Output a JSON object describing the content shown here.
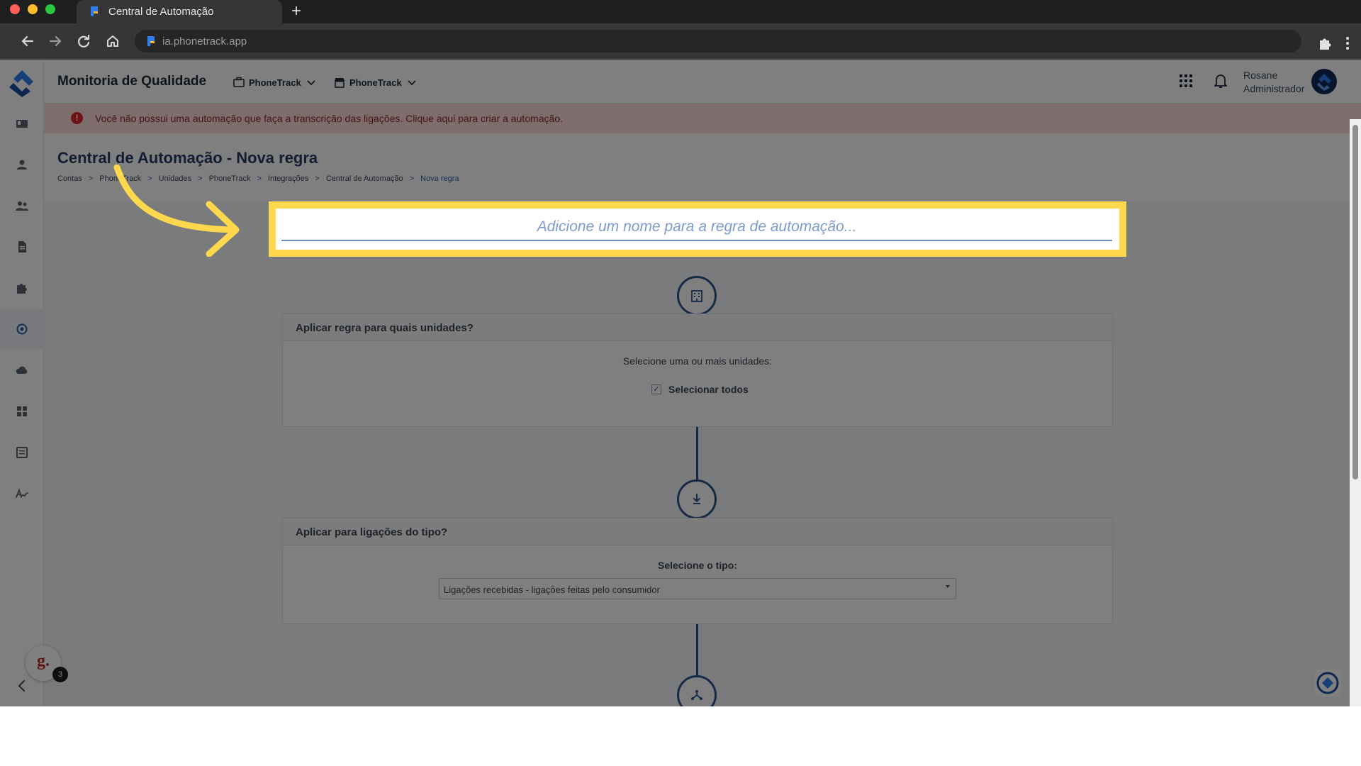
{
  "browser": {
    "tab_title": "Central de Automação",
    "url": "ia.phonetrack.app",
    "new_tab_symbol": "+"
  },
  "app": {
    "title": "Monitoria de Qualidade",
    "org_selectors": [
      "PhoneTrack",
      "PhoneTrack"
    ],
    "user": {
      "name": "Rosane",
      "role": "Administrador"
    }
  },
  "alert": {
    "icon_text": "!",
    "text": "Você não possui uma automação que faça a transcrição das ligações. Clique aqui para criar a automação."
  },
  "page": {
    "title": "Central de Automação - Nova regra",
    "breadcrumb": [
      "Contas",
      "PhoneTrack",
      "Unidades",
      "PhoneTrack",
      "Integrações",
      "Central de Automação",
      "Nova regra"
    ],
    "breadcrumb_separator": ">"
  },
  "rule_name": {
    "placeholder": "Adicione um nome para a regra de automação...",
    "value": ""
  },
  "units_card": {
    "header": "Aplicar regra para quais unidades?",
    "label": "Selecione uma ou mais unidades:",
    "select_all": "Selecionar todos",
    "select_all_checked": true
  },
  "type_card": {
    "header": "Aplicar para ligações do tipo?",
    "label": "Selecione o tipo:",
    "selected": "Ligações recebidas - ligações feitas pelo consumidor"
  },
  "widgets": {
    "g_letter": "g.",
    "notification_count": "3"
  },
  "colors": {
    "highlight": "#ffd84d",
    "annotation_arrow": "#ffd84d",
    "brand": "#2d5590",
    "alert_bg": "#fbdad8"
  }
}
